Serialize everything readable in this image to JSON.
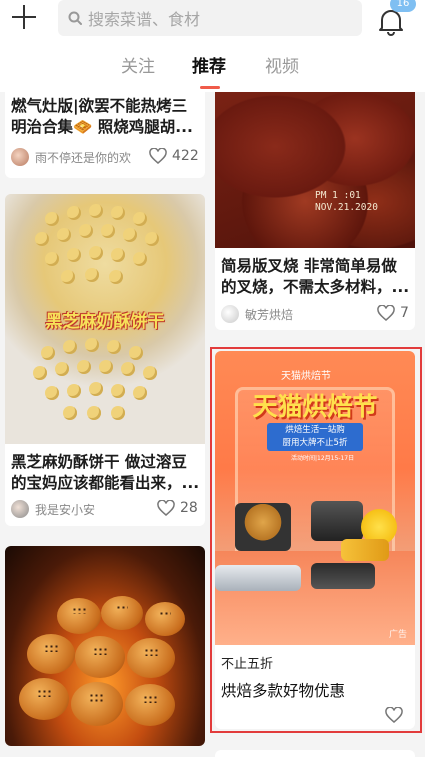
{
  "header": {
    "search_placeholder": "搜索菜谱、食材",
    "notification_count": "16"
  },
  "tabs": [
    {
      "label": "关注",
      "active": false
    },
    {
      "label": "推荐",
      "active": true
    },
    {
      "label": "视频",
      "active": false
    }
  ],
  "feed": {
    "card1": {
      "title": "燃气灶版|欲罢不能热烤三明治合集🧇 照烧鸡腿胡...",
      "author": "雨不停还是你的欢",
      "likes": "422"
    },
    "card2": {
      "photo_stamp_line1": "PM 1 :01",
      "photo_stamp_line2": "NOV.21.2020",
      "title": "简易版叉烧 非常简单易做的叉烧，不需太多材料，...",
      "author": "敏芳烘焙",
      "likes": "7"
    },
    "card3": {
      "image_label": "黑芝麻奶酥饼干",
      "title": "黑芝麻奶酥饼干 做过溶豆的宝妈应该都能看出来，...",
      "author": "我是安小安",
      "likes": "28"
    },
    "ad": {
      "banner_top": "天猫烘焙节",
      "banner_title": "天猫烘焙节",
      "banner_sub_line1": "烘焙生活一站购",
      "banner_sub_line2": "厨用大牌不止5折",
      "banner_date": "活动时间|12月15-17日",
      "ad_marker": "广告",
      "caption": "不止五折",
      "headline": "烘焙多款好物优惠"
    }
  },
  "colors": {
    "tab_accent": "#f05b4a",
    "badge": "#7fbff2",
    "ad_highlight_border": "#e23b3b"
  }
}
